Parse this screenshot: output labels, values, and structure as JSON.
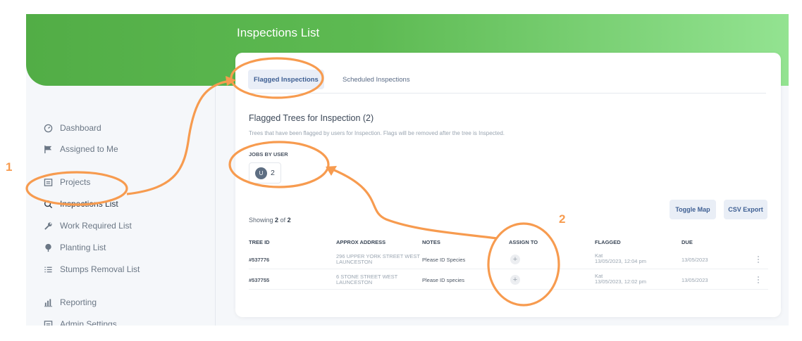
{
  "page": {
    "title": "Inspections List"
  },
  "sidebar": {
    "items": [
      {
        "label": "Dashboard",
        "icon": "dashboard-icon"
      },
      {
        "label": "Assigned to Me",
        "icon": "flag-icon"
      },
      {
        "label": "Projects",
        "icon": "projects-icon"
      },
      {
        "label": "Inspections List",
        "icon": "search-icon"
      },
      {
        "label": "Work Required List",
        "icon": "wrench-icon"
      },
      {
        "label": "Planting List",
        "icon": "tree-icon"
      },
      {
        "label": "Stumps Removal List",
        "icon": "list-icon"
      },
      {
        "label": "Reporting",
        "icon": "bar-chart-icon"
      },
      {
        "label": "Admin Settings",
        "icon": "settings-icon"
      }
    ]
  },
  "tabs": [
    {
      "label": "Flagged Inspections"
    },
    {
      "label": "Scheduled Inspections"
    }
  ],
  "section": {
    "title": "Flagged Trees for Inspection (2)",
    "description": "Trees that have been flagged by users for Inspection. Flags will be removed after the tree is Inspected.",
    "jobs_label": "JOBS BY USER",
    "user_chip": {
      "initial": "U",
      "count": "2"
    }
  },
  "buttons": {
    "toggle_map": "Toggle Map",
    "csv_export": "CSV Export"
  },
  "showing": {
    "prefix": "Showing",
    "shown": "2",
    "of": "of",
    "total": "2"
  },
  "table": {
    "headers": [
      "TREE ID",
      "APPROX ADDRESS",
      "NOTES",
      "ASSIGN TO",
      "FLAGGED",
      "DUE"
    ],
    "rows": [
      {
        "id": "#537776",
        "address_line1": "296 UPPER YORK STREET WEST",
        "address_line2": "LAUNCESTON",
        "notes": "Please ID Species",
        "assign": "+",
        "flagged_by": "Kat",
        "flagged_at": "13/05/2023, 12:04 pm",
        "due": "13/05/2023"
      },
      {
        "id": "#537755",
        "address_line1": "6 STONE STREET WEST",
        "address_line2": "LAUNCESTON",
        "notes": "Please ID species",
        "assign": "+",
        "flagged_by": "Kat",
        "flagged_at": "13/05/2023, 12:02 pm",
        "due": "13/05/2023"
      }
    ]
  },
  "annotations": {
    "label_1": "1",
    "label_2": "2",
    "color": "#f79b4f"
  },
  "colors": {
    "header_start": "#52ad46",
    "header_end": "#93e391",
    "accent_blue": "#3e5f93",
    "annotation": "#f79b4f"
  }
}
